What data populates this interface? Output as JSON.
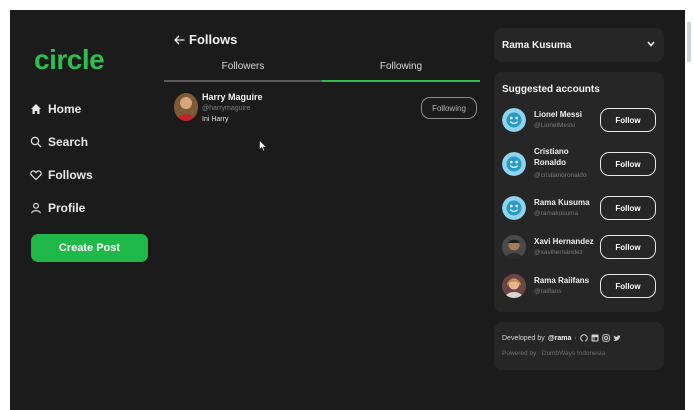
{
  "app": {
    "logo": "circle"
  },
  "theme": {
    "accent": "#2fbd4d",
    "button_green": "#1fb94a",
    "bg": "#1b1b1b",
    "card": "#262626"
  },
  "nav": {
    "items": [
      {
        "label": "Home",
        "icon": "home-icon"
      },
      {
        "label": "Search",
        "icon": "search-icon"
      },
      {
        "label": "Follows",
        "icon": "heart-icon"
      },
      {
        "label": "Profile",
        "icon": "user-icon"
      }
    ],
    "create_label": "Create Post"
  },
  "follows": {
    "title": "Follows",
    "tabs": [
      {
        "label": "Followers",
        "active": false
      },
      {
        "label": "Following",
        "active": true
      }
    ],
    "rows": [
      {
        "name": "Harry Maguire",
        "handle": "@harrymaguire",
        "bio": "Ini Harry",
        "button": "Following"
      }
    ]
  },
  "profile": {
    "name": "Rama Kusuma"
  },
  "suggested": {
    "title": "Suggested accounts",
    "accounts": [
      {
        "name": "Lionel Messi",
        "handle": "@LionelMessi",
        "button": "Follow",
        "avatar": "smiley-icon"
      },
      {
        "name": "Cristiano Ronaldo",
        "handle": "@cristianoronaldo",
        "button": "Follow",
        "avatar": "smiley-icon"
      },
      {
        "name": "Rama Kusuma",
        "handle": "@ramakusuma",
        "button": "Follow",
        "avatar": "smiley-icon"
      },
      {
        "name": "Xavi Hernandez",
        "handle": "@xavihernandez",
        "button": "Follow",
        "avatar": "photo"
      },
      {
        "name": "Rama Raiifans",
        "handle": "@raiifans",
        "button": "Follow",
        "avatar": "photo"
      }
    ]
  },
  "footer": {
    "developed_prefix": "Developed by",
    "developer": "@rama",
    "separator": "·",
    "powered_by": "Powered by",
    "powered_org": "DumbWays Indonesia"
  }
}
